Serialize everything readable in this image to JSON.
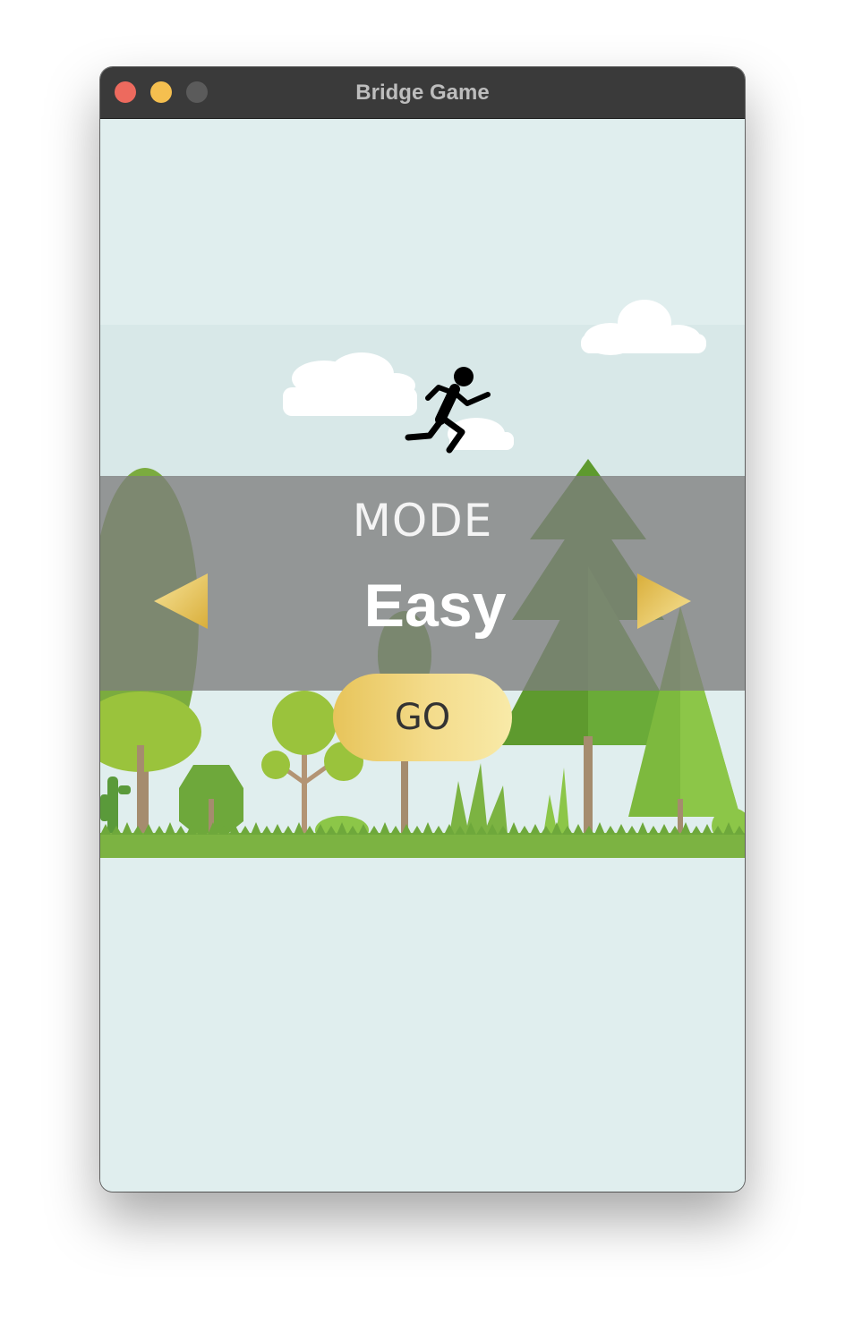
{
  "window": {
    "title": "Bridge Game"
  },
  "menu": {
    "mode_label": "MODE",
    "mode_value": "Easy",
    "go_label": "GO"
  },
  "icons": {
    "previous": "triangle-left-icon",
    "next": "triangle-right-icon",
    "player": "running-person-icon"
  },
  "colors": {
    "background": "#e0eeee",
    "titlebar": "#3a3a3a",
    "band": "#7d7d7d",
    "gold": "#e7c45a",
    "grass": "#7cb342"
  }
}
